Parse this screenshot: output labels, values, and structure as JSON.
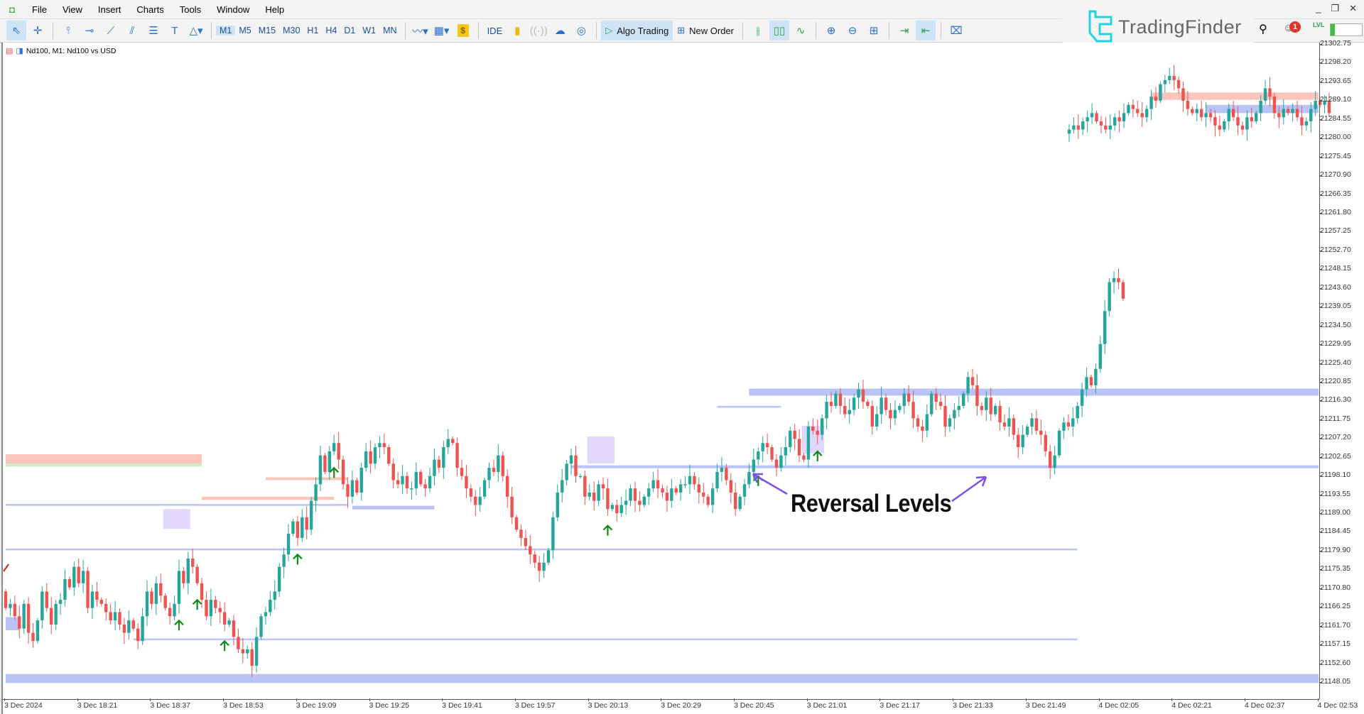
{
  "menubar": {
    "items": [
      "File",
      "View",
      "Insert",
      "Charts",
      "Tools",
      "Window",
      "Help"
    ]
  },
  "window_controls": {
    "minimize": "_",
    "restore": "❐",
    "close": "✕"
  },
  "toolbar": {
    "timeframes": [
      "M1",
      "M5",
      "M15",
      "M30",
      "H1",
      "H4",
      "D1",
      "W1",
      "MN"
    ],
    "active_timeframe": "M1",
    "ide_label": "IDE",
    "algo_trading_label": "Algo Trading",
    "new_order_label": "New Order",
    "notification_count": "1",
    "lvl_label": "LVL",
    "icons": [
      "cursor-icon",
      "crosshair-icon",
      "vertical-line-icon",
      "horizontal-line-icon",
      "trendline-icon",
      "channel-icon",
      "fibonacci-icon",
      "text-icon",
      "shapes-icon",
      "indicators-icon",
      "templates-icon",
      "market-icon",
      "signals-icon",
      "vps-icon",
      "hosting-icon",
      "bar-chart-icon",
      "candlestick-icon",
      "line-chart-icon",
      "zoom-in-icon",
      "zoom-out-icon",
      "tile-windows-icon",
      "autoscroll-icon",
      "chart-shift-icon",
      "screenshot-icon",
      "search-icon",
      "account-icon"
    ]
  },
  "branding": {
    "logo_text": "TradingFinder",
    "logo_color": "#22d3e6"
  },
  "chart": {
    "label": "Nd100, M1:  Nd100 vs USD",
    "annotation": "Reversal Levels",
    "colors": {
      "bull": "#26a69a",
      "bear": "#ef5350",
      "supply_zone": "#fbc4bd",
      "demand_zone": "#b9c3f6",
      "reversal_box": "#dcd0fa",
      "arrow": "#118a1a",
      "annot_arrow": "#7b4fe8",
      "green_zone": "#c8f0c0"
    }
  },
  "chart_data": {
    "type": "candlestick",
    "symbol": "Nd100",
    "timeframe": "M1",
    "price_ticks": [
      "21302.75",
      "21298.20",
      "21293.65",
      "21289.10",
      "21284.55",
      "21280.00",
      "21275.45",
      "21270.90",
      "21266.35",
      "21261.80",
      "21257.25",
      "21252.70",
      "21248.15",
      "21243.60",
      "21239.05",
      "21234.50",
      "21229.95",
      "21225.40",
      "21220.85",
      "21216.30",
      "21211.75",
      "21207.20",
      "21202.65",
      "21198.10",
      "21193.55",
      "21189.00",
      "21184.45",
      "21179.90",
      "21175.35",
      "21170.80",
      "21166.25",
      "21161.70",
      "21157.15",
      "21152.60",
      "21148.05"
    ],
    "ylim": [
      21146.0,
      21303.5
    ],
    "time_ticks": [
      "3 Dec 2024",
      "3 Dec 18:21",
      "3 Dec 18:37",
      "3 Dec 18:53",
      "3 Dec 19:09",
      "3 Dec 19:25",
      "3 Dec 19:41",
      "3 Dec 19:57",
      "3 Dec 20:13",
      "3 Dec 20:29",
      "3 Dec 20:45",
      "3 Dec 21:01",
      "3 Dec 21:17",
      "3 Dec 21:33",
      "3 Dec 21:49",
      "4 Dec 02:05",
      "4 Dec 02:21",
      "4 Dec 02:37",
      "4 Dec 02:53"
    ],
    "closes_segment1": [
      21166,
      21167,
      21164,
      21161,
      21167,
      21160,
      21158,
      21163,
      21170,
      21166,
      21162,
      21167,
      21168,
      21173,
      21171,
      21176,
      21172,
      21175,
      21166,
      21170,
      21168,
      21167,
      21165,
      21163,
      21165,
      21162,
      21160,
      21163,
      21161,
      21158,
      21164,
      21170,
      21167,
      21172,
      21169,
      21166,
      21164,
      21167,
      21175,
      21172,
      21178,
      21176,
      21172,
      21168,
      21164,
      21168,
      21166,
      21165,
      21162,
      21163,
      21159,
      21156,
      21155,
      21156,
      21152,
      21159,
      21164,
      21165,
      21168,
      21170,
      21176,
      21179,
      21184,
      21187,
      21183,
      21188,
      21185,
      21192,
      21196,
      21203,
      21199,
      21204,
      21206,
      21202,
      21196,
      21193,
      21197,
      21194,
      21200,
      21204,
      21201,
      21205,
      21206,
      21205,
      21201,
      21197,
      21196,
      21198,
      21195,
      21195,
      21199,
      21196,
      21195,
      21198,
      21202,
      21200,
      21205,
      21207,
      21206,
      21200,
      21198,
      21195,
      21193,
      21191,
      21193,
      21197,
      21200,
      21199,
      21203,
      21198,
      21193,
      21188,
      21185,
      21183,
      21181,
      21179,
      21177,
      21175,
      21177,
      21180,
      21188,
      21194,
      21197,
      21201,
      21203,
      21198,
      21198,
      21193,
      21194,
      21192,
      21196,
      21195,
      21190,
      21191,
      21189,
      21191,
      21192,
      21195,
      21192,
      21191,
      21193,
      21195,
      21197,
      21195,
      21194,
      21192,
      21195,
      21194,
      21196,
      21196,
      21198,
      21196,
      21194,
      21193,
      21191,
      21195,
      21199,
      21200,
      21197,
      21194,
      21190,
      21193,
      21196,
      21199,
      21202,
      21204,
      21206,
      21205,
      21202,
      21200,
      21203,
      21205,
      21209,
      21207,
      21203,
      21202,
      21210,
      21209,
      21208,
      21212,
      21216,
      21215,
      21218,
      21215,
      21213,
      21214,
      21217,
      21219,
      21216,
      21215,
      21210,
      21213,
      21217,
      21214,
      21212,
      21214,
      21215,
      21218,
      21216,
      21212,
      21210,
      21209,
      21213,
      21218,
      21216,
      21215,
      21210,
      21212,
      21214,
      21215,
      21218,
      21222,
      21220,
      21215,
      21214,
      21217,
      21213,
      21215,
      21211,
      21210,
      21212,
      21208,
      21205,
      21208,
      21210,
      21212,
      21209,
      21208,
      21204,
      21200,
      21203,
      21209,
      21211,
      21210,
      21212,
      21215,
      21219,
      21222,
      21220,
      21224,
      21230,
      21238,
      21245,
      21246,
      21245,
      21241
    ],
    "closes_segment2": [
      21282,
      21283,
      21282,
      21284,
      21285,
      21286,
      21284,
      21283,
      21282,
      21283,
      21285,
      21284,
      21286,
      21288,
      21287,
      21286,
      21285,
      21287,
      21290,
      21289,
      21293,
      21294,
      21295,
      21294,
      21292,
      21289,
      21287,
      21286,
      21287,
      21285,
      21286,
      21285,
      21283,
      21282,
      21284,
      21287,
      21285,
      21283,
      21282,
      21285,
      21284,
      21286,
      21289,
      21292,
      21290,
      21286,
      21285,
      21287,
      21286,
      21287,
      21285,
      21283,
      21284,
      21287,
      21289,
      21288,
      21289,
      21286
    ],
    "zones": [
      {
        "kind": "supply",
        "from_index": 0,
        "to_index": 43,
        "price_top": 21203.3,
        "price_bottom": 21201.0
      },
      {
        "kind": "green",
        "from_index": 0,
        "to_index": 43,
        "price_top": 21201.0,
        "price_bottom": 21200.3
      },
      {
        "kind": "demand_line",
        "from_index": 0,
        "to_index": 75,
        "price": 21191.0
      },
      {
        "kind": "supply",
        "from_index": 43,
        "to_index": 72,
        "price_top": 21193.0,
        "price_bottom": 21192.2
      },
      {
        "kind": "supply",
        "from_index": 57,
        "to_index": 75,
        "price_top": 21197.7,
        "price_bottom": 21197.0
      },
      {
        "kind": "demand_line",
        "from_index": 0,
        "to_index": 235,
        "price": 21180.2
      },
      {
        "kind": "demand_line",
        "from_index": 28,
        "to_index": 235,
        "price": 21158.4
      },
      {
        "kind": "demand",
        "from_index": 0,
        "to_index": 235,
        "price_top": 21150.0,
        "price_bottom": 21147.8
      },
      {
        "kind": "demand",
        "from_index": 0,
        "to_index": 3,
        "price_top": 21163.8,
        "price_bottom": 21160.6
      },
      {
        "kind": "demand",
        "from_index": 76,
        "to_index": 94,
        "price_top": 21190.8,
        "price_bottom": 21189.9
      },
      {
        "kind": "demand",
        "from_index": 163,
        "to_index": 235,
        "price_top": 21219.2,
        "price_bottom": 21217.5
      },
      {
        "kind": "demand_line",
        "from_index": 156,
        "to_index": 170,
        "price": 21214.8
      },
      {
        "kind": "demand",
        "from_index": 124,
        "to_index": 235,
        "price_top": 21200.6,
        "price_bottom": 21199.9
      },
      {
        "kind": "supply_r",
        "from_index": 264,
        "to_index": 293,
        "price_top": 21291.0,
        "price_bottom": 21289.2
      },
      {
        "kind": "demand_r",
        "from_index": 276,
        "to_index": 291,
        "price_top": 21288.0,
        "price_bottom": 21286.0
      }
    ],
    "reversal_boxes": [
      {
        "from_index": 35,
        "to_index": 40,
        "price_top": 21190.0,
        "price_bottom": 21185.2
      },
      {
        "from_index": 128,
        "to_index": 133,
        "price_top": 21207.6,
        "price_bottom": 21201.0
      },
      {
        "from_index": 175,
        "to_index": 179,
        "price_top": 21210.2,
        "price_bottom": 21203.5
      }
    ],
    "signal_arrows": [
      38,
      42,
      48,
      64,
      72,
      132,
      165,
      178
    ]
  }
}
